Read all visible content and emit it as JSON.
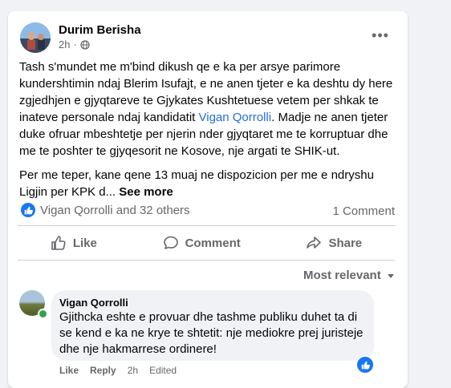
{
  "post": {
    "author": "Durim Berisha",
    "time": "2h",
    "time_sep": "·",
    "privacy_icon": "globe-icon",
    "more_icon": "•••",
    "paragraph1_part1": "Tash s'mundet me m'bind dikush qe e ka per arsye parimore kundershtimin ndaj Blerim Isufajt, e ne anen tjeter e ka deshtu dy here zgjedhjen e gjyqtareve te Gjykates Kushtetuese vetem per shkak te inateve personale ndaj kandidatit ",
    "paragraph1_link": "Vigan Qorrolli",
    "paragraph1_part2": ". Madje ne anen tjeter duke ofruar mbeshtetje per njerin nder gjyqtaret me te korruptuar dhe me te poshter te gjyqesorit ne Kosove, nje argati te SHIK-ut.",
    "paragraph2": "Per me teper, kane qene 13 muaj ne dispozicion per me e ndryshu Ligjin per KPK d... ",
    "see_more": "See more"
  },
  "reactions": {
    "summary": "Vigan Qorrolli and 32 others",
    "comments": "1 Comment"
  },
  "actions": {
    "like": "Like",
    "comment": "Comment",
    "share": "Share"
  },
  "sort": {
    "label": "Most relevant"
  },
  "comment": {
    "author": "Vigan Qorrolli",
    "text": "Gjithcka eshte e provuar dhe tashme publiku duhet ta di se kend e ka ne krye te shtetit: nje mediokre prej juristeje dhe nje hakmarrese ordinere!",
    "like": "Like",
    "reply": "Reply",
    "time": "2h",
    "edited": "Edited"
  },
  "colors": {
    "accent": "#1877f2",
    "link": "#216fdb",
    "muted": "#65676b",
    "online": "#31a24c"
  }
}
